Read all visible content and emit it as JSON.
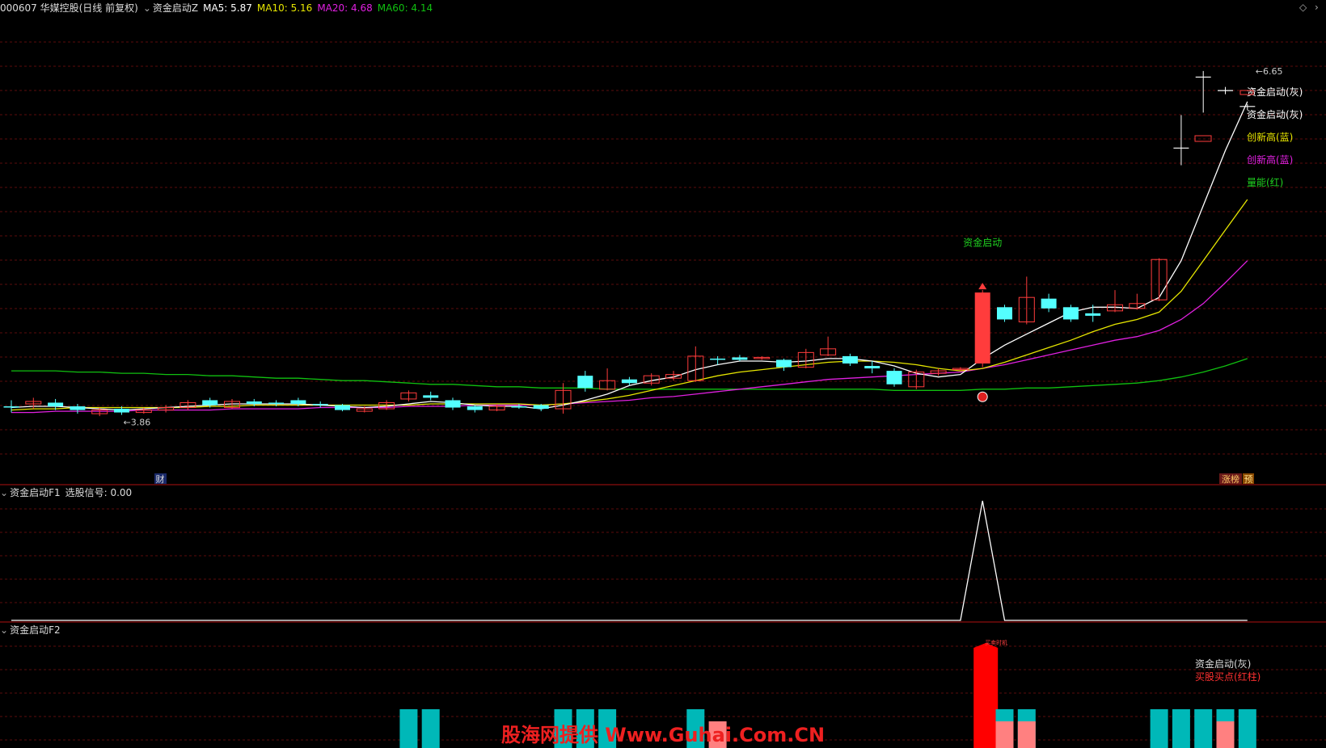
{
  "colors": {
    "bg": "#000000",
    "grid": "#7a1010",
    "divider": "#b01010",
    "up": "#ff3c3c",
    "down": "#54ffff",
    "text": "#cccccc",
    "ma5": "#ffffff",
    "ma10": "#e6e600",
    "ma20": "#e020e0",
    "ma60": "#10c010",
    "green_label": "#20d020",
    "watermark": "#ee2020",
    "pink_bar": "#ff8080",
    "teal_bar": "#00b8b8"
  },
  "header": {
    "stock": "000607 华媒控股(日线 前复权)",
    "indicator": "资金启动Z",
    "ma5": "MA5: 5.87",
    "ma10": "MA10: 5.16",
    "ma20": "MA20: 4.68",
    "ma60": "MA60: 4.14"
  },
  "panel_f1": {
    "title": "资金启动F1",
    "value": "选股信号: 0.00"
  },
  "panel_f2": {
    "title": "资金启动F2"
  },
  "annotations": {
    "high": "6.65",
    "low": "3.86",
    "start_label": "资金启动",
    "cai": "财",
    "zhangbang": "涨榜",
    "yu": "预",
    "legend": [
      "资金启动(灰)",
      "资金启动(灰)",
      "创新高(蓝)",
      "创新高(蓝)",
      "量能(红)"
    ],
    "f2_legend_1": "资金启动(灰)",
    "f2_legend_2": "买股买点(红柱)",
    "f2_small": "买卖时机"
  },
  "watermark": "股海网提供 Www.Guhai.Com.CN",
  "chart_data": {
    "type": "candlestick",
    "price_range": [
      3.6,
      6.9
    ],
    "candles": [
      [
        3.91,
        3.9,
        3.96,
        3.86
      ],
      [
        3.93,
        3.95,
        3.98,
        3.89
      ],
      [
        3.94,
        3.91,
        3.97,
        3.88
      ],
      [
        3.91,
        3.88,
        3.93,
        3.85
      ],
      [
        3.85,
        3.88,
        3.9,
        3.83
      ],
      [
        3.89,
        3.86,
        3.91,
        3.84
      ],
      [
        3.86,
        3.88,
        3.9,
        3.85
      ],
      [
        3.88,
        3.9,
        3.92,
        3.86
      ],
      [
        3.9,
        3.94,
        3.96,
        3.88
      ],
      [
        3.96,
        3.92,
        3.98,
        3.9
      ],
      [
        3.9,
        3.95,
        3.97,
        3.89
      ],
      [
        3.95,
        3.93,
        3.97,
        3.91
      ],
      [
        3.94,
        3.93,
        3.96,
        3.91
      ],
      [
        3.96,
        3.93,
        3.98,
        3.91
      ],
      [
        3.93,
        3.92,
        3.95,
        3.9
      ],
      [
        3.92,
        3.88,
        3.93,
        3.87
      ],
      [
        3.87,
        3.89,
        3.91,
        3.86
      ],
      [
        3.89,
        3.94,
        3.96,
        3.88
      ],
      [
        3.97,
        4.02,
        4.04,
        3.95
      ],
      [
        4.0,
        3.98,
        4.03,
        3.96
      ],
      [
        3.96,
        3.9,
        3.98,
        3.88
      ],
      [
        3.91,
        3.88,
        3.92,
        3.86
      ],
      [
        3.88,
        3.91,
        3.93,
        3.87
      ],
      [
        3.91,
        3.9,
        3.93,
        3.89
      ],
      [
        3.92,
        3.89,
        3.93,
        3.87
      ],
      [
        3.89,
        4.04,
        4.1,
        3.85
      ],
      [
        4.16,
        4.06,
        4.2,
        4.03
      ],
      [
        4.05,
        4.12,
        4.22,
        4.04
      ],
      [
        4.13,
        4.1,
        4.15,
        4.08
      ],
      [
        4.1,
        4.16,
        4.18,
        4.08
      ],
      [
        4.14,
        4.17,
        4.2,
        4.12
      ],
      [
        4.12,
        4.32,
        4.4,
        4.11
      ],
      [
        4.3,
        4.29,
        4.32,
        4.25
      ],
      [
        4.31,
        4.29,
        4.33,
        4.28
      ],
      [
        4.3,
        4.31,
        4.32,
        4.29
      ],
      [
        4.29,
        4.23,
        4.3,
        4.2
      ],
      [
        4.23,
        4.35,
        4.38,
        4.22
      ],
      [
        4.33,
        4.38,
        4.48,
        4.32
      ],
      [
        4.32,
        4.26,
        4.34,
        4.24
      ],
      [
        4.24,
        4.22,
        4.28,
        4.18
      ],
      [
        4.2,
        4.09,
        4.22,
        4.07
      ],
      [
        4.07,
        4.19,
        4.21,
        4.05
      ],
      [
        4.18,
        4.2,
        4.22,
        4.16
      ],
      [
        4.21,
        4.22,
        4.23,
        4.2
      ],
      [
        4.26,
        4.84,
        4.86,
        4.23
      ],
      [
        4.72,
        4.62,
        4.74,
        4.6
      ],
      [
        4.6,
        4.8,
        4.97,
        4.58
      ],
      [
        4.79,
        4.71,
        4.83,
        4.68
      ],
      [
        4.72,
        4.62,
        4.74,
        4.6
      ],
      [
        4.67,
        4.65,
        4.74,
        4.6
      ],
      [
        4.69,
        4.74,
        4.86,
        4.68
      ],
      [
        4.71,
        4.75,
        4.83,
        4.7
      ],
      [
        4.78,
        5.11,
        5.12,
        4.77
      ],
      [
        6.02,
        6.02,
        6.29,
        5.88
      ],
      [
        6.6,
        6.6,
        6.65,
        6.31
      ],
      [
        6.48,
        6.49,
        6.52,
        6.46
      ],
      [
        6.35,
        6.36,
        6.38,
        6.33
      ]
    ],
    "ma5": [
      3.9,
      3.91,
      3.91,
      3.9,
      3.89,
      3.88,
      3.89,
      3.9,
      3.91,
      3.92,
      3.93,
      3.93,
      3.93,
      3.93,
      3.92,
      3.91,
      3.9,
      3.91,
      3.93,
      3.95,
      3.94,
      3.92,
      3.91,
      3.91,
      3.89,
      3.92,
      3.96,
      4.01,
      4.08,
      4.12,
      4.15,
      4.21,
      4.25,
      4.28,
      4.28,
      4.27,
      4.28,
      4.3,
      4.3,
      4.28,
      4.24,
      4.18,
      4.15,
      4.17,
      4.3,
      4.41,
      4.5,
      4.59,
      4.68,
      4.72,
      4.72,
      4.71,
      4.8,
      5.1,
      5.55,
      6.0,
      6.4
    ],
    "ma10": [
      3.88,
      3.89,
      3.89,
      3.9,
      3.9,
      3.9,
      3.9,
      3.9,
      3.9,
      3.91,
      3.91,
      3.92,
      3.92,
      3.92,
      3.92,
      3.92,
      3.92,
      3.92,
      3.92,
      3.93,
      3.93,
      3.93,
      3.93,
      3.93,
      3.92,
      3.93,
      3.95,
      3.97,
      4.0,
      4.04,
      4.08,
      4.12,
      4.16,
      4.19,
      4.21,
      4.23,
      4.25,
      4.27,
      4.28,
      4.28,
      4.27,
      4.25,
      4.22,
      4.2,
      4.22,
      4.27,
      4.33,
      4.39,
      4.45,
      4.52,
      4.58,
      4.62,
      4.68,
      4.85,
      5.1,
      5.35,
      5.6
    ],
    "ma20": [
      3.86,
      3.86,
      3.87,
      3.87,
      3.87,
      3.87,
      3.88,
      3.88,
      3.88,
      3.88,
      3.89,
      3.89,
      3.89,
      3.89,
      3.9,
      3.9,
      3.9,
      3.9,
      3.91,
      3.91,
      3.91,
      3.92,
      3.92,
      3.92,
      3.92,
      3.93,
      3.94,
      3.95,
      3.96,
      3.98,
      3.99,
      4.01,
      4.03,
      4.05,
      4.07,
      4.09,
      4.11,
      4.13,
      4.14,
      4.15,
      4.16,
      4.17,
      4.18,
      4.19,
      4.22,
      4.25,
      4.29,
      4.33,
      4.37,
      4.41,
      4.45,
      4.48,
      4.53,
      4.62,
      4.75,
      4.92,
      5.1
    ],
    "ma60": [
      4.2,
      4.2,
      4.2,
      4.19,
      4.19,
      4.18,
      4.18,
      4.17,
      4.17,
      4.16,
      4.16,
      4.15,
      4.14,
      4.14,
      4.13,
      4.12,
      4.12,
      4.11,
      4.1,
      4.09,
      4.09,
      4.08,
      4.07,
      4.07,
      4.06,
      4.06,
      4.06,
      4.05,
      4.05,
      4.05,
      4.05,
      4.05,
      4.05,
      4.05,
      4.05,
      4.05,
      4.05,
      4.05,
      4.05,
      4.05,
      4.04,
      4.04,
      4.04,
      4.04,
      4.05,
      4.05,
      4.06,
      4.06,
      4.07,
      4.08,
      4.09,
      4.1,
      4.12,
      4.15,
      4.19,
      4.24,
      4.3
    ],
    "f1_signal_index": 44,
    "f2_bars": [
      {
        "i": 18,
        "teal": 1
      },
      {
        "i": 19,
        "teal": 1
      },
      {
        "i": 25,
        "teal": 1
      },
      {
        "i": 26,
        "teal": 1
      },
      {
        "i": 27,
        "teal": 1
      },
      {
        "i": 31,
        "teal": 1
      },
      {
        "i": 32,
        "pink": 1
      },
      {
        "i": 44,
        "red": 1
      },
      {
        "i": 45,
        "teal": 1,
        "pink": 1
      },
      {
        "i": 46,
        "teal": 1,
        "pink": 1
      },
      {
        "i": 52,
        "teal": 1
      },
      {
        "i": 53,
        "teal": 1
      },
      {
        "i": 54,
        "teal": 1
      },
      {
        "i": 55,
        "teal": 1,
        "pink": 1
      },
      {
        "i": 56,
        "teal": 1
      }
    ]
  }
}
